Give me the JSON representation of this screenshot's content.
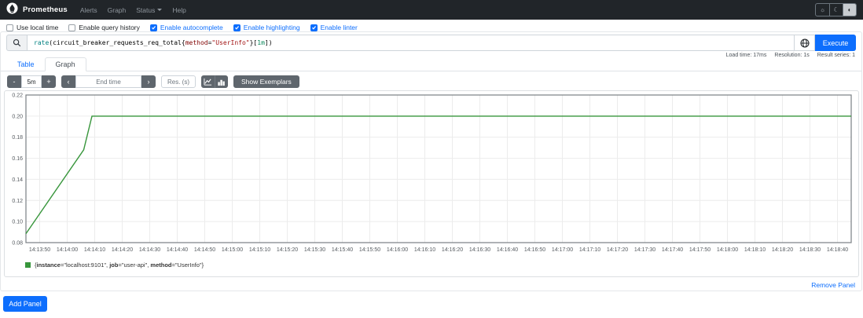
{
  "navbar": {
    "brand": "Prometheus",
    "links": [
      {
        "label": "Alerts"
      },
      {
        "label": "Graph"
      },
      {
        "label": "Status",
        "caret": true
      },
      {
        "label": "Help"
      }
    ],
    "theme_buttons": [
      {
        "name": "light",
        "glyph": "☼",
        "active": false
      },
      {
        "name": "dark",
        "glyph": "☾",
        "active": false
      },
      {
        "name": "auto",
        "glyph": "◐",
        "active": true
      }
    ]
  },
  "options": [
    {
      "label": "Use local time",
      "checked": false
    },
    {
      "label": "Enable query history",
      "checked": false
    },
    {
      "label": "Enable autocomplete",
      "checked": true
    },
    {
      "label": "Enable highlighting",
      "checked": true
    },
    {
      "label": "Enable linter",
      "checked": true
    }
  ],
  "query": {
    "tokens": [
      {
        "type": "fn",
        "text": "rate"
      },
      {
        "type": "paren",
        "text": "("
      },
      {
        "type": "metric",
        "text": "circuit_breaker_requests_req_total"
      },
      {
        "type": "brace",
        "text": "{"
      },
      {
        "type": "label",
        "text": "method"
      },
      {
        "type": "op",
        "text": "="
      },
      {
        "type": "str",
        "text": "\"UserInfo\""
      },
      {
        "type": "brace",
        "text": "}"
      },
      {
        "type": "bracket",
        "text": "["
      },
      {
        "type": "dur",
        "text": "1m"
      },
      {
        "type": "bracket",
        "text": "]"
      },
      {
        "type": "paren",
        "text": ")"
      }
    ],
    "execute_label": "Execute"
  },
  "stats": {
    "load_time": "Load time: 17ms",
    "resolution": "Resolution: 1s",
    "result_series": "Result series: 1"
  },
  "tabs": [
    {
      "label": "Table",
      "active": false
    },
    {
      "label": "Graph",
      "active": true
    }
  ],
  "controls": {
    "zoom_out": "-",
    "range_value": "5m",
    "zoom_in": "+",
    "prev": "‹",
    "end_time_placeholder": "End time",
    "next": "›",
    "res_placeholder": "Res. (s)",
    "show_exemplars": "Show Exemplars"
  },
  "chart_data": {
    "type": "line",
    "title": "",
    "xlabel": "",
    "ylabel": "",
    "grid": true,
    "legend_position": "bottom",
    "xlim": [
      "14:13:45",
      "14:18:45"
    ],
    "ylim": [
      0.08,
      0.22
    ],
    "yticks": [
      "0.22",
      "0.20",
      "0.18",
      "0.16",
      "0.14",
      "0.12",
      "0.10",
      "0.08"
    ],
    "xticks": [
      "14:13:50",
      "14:14:00",
      "14:14:10",
      "14:14:20",
      "14:14:30",
      "14:14:40",
      "14:14:50",
      "14:15:00",
      "14:15:10",
      "14:15:20",
      "14:15:30",
      "14:15:40",
      "14:15:50",
      "14:16:00",
      "14:16:10",
      "14:16:20",
      "14:16:30",
      "14:16:40",
      "14:16:50",
      "14:17:00",
      "14:17:10",
      "14:17:20",
      "14:17:30",
      "14:17:40",
      "14:17:50",
      "14:18:00",
      "14:18:10",
      "14:18:20",
      "14:18:30",
      "14:18:40"
    ],
    "series": [
      {
        "name": "{instance=\"localhost:9101\", job=\"user-api\", method=\"UserInfo\"}",
        "color": "#38963c",
        "points": [
          [
            "14:13:45",
            0.0885
          ],
          [
            "14:14:06",
            0.168
          ],
          [
            "14:14:09",
            0.2
          ],
          [
            "14:18:45",
            0.2
          ]
        ],
        "legend_parts": [
          {
            "text": "{",
            "bold": false
          },
          {
            "text": "instance",
            "bold": true
          },
          {
            "text": "=\"localhost:9101\", ",
            "bold": false
          },
          {
            "text": "job",
            "bold": true
          },
          {
            "text": "=\"user-api\", ",
            "bold": false
          },
          {
            "text": "method",
            "bold": true
          },
          {
            "text": "=\"UserInfo\"}",
            "bold": false
          }
        ]
      }
    ]
  },
  "panel": {
    "remove_label": "Remove Panel"
  },
  "add_panel_label": "Add Panel",
  "colors": {
    "accent": "#0d6efd",
    "secondary_button": "#5f666d",
    "navbar_bg": "#212529",
    "series_green": "#38963c"
  }
}
